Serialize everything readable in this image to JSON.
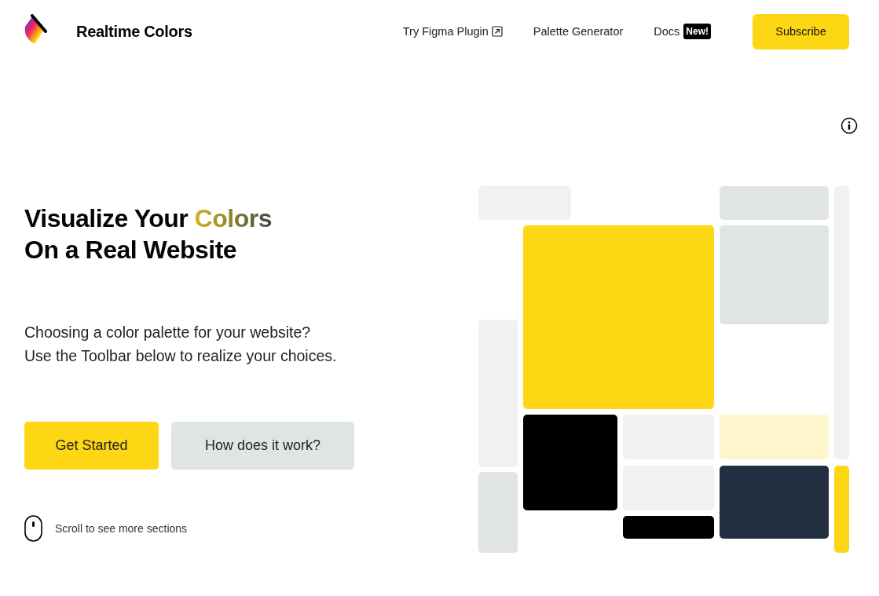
{
  "brand": {
    "name": "Realtime Colors"
  },
  "nav": [
    {
      "label": "Try Figma Plugin",
      "kind": "external"
    },
    {
      "label": "Palette Generator",
      "kind": "plain"
    },
    {
      "label": "Docs",
      "kind": "badge",
      "badge": "New!"
    }
  ],
  "subscribe": "Subscribe",
  "hero": {
    "lead": "Visualize Your",
    "highlight": "Colors",
    "second_line": "On a Real Website",
    "text": [
      "Choosing a color palette for your website?",
      "Use the Toolbar below to realize your choices."
    ],
    "buttons": [
      {
        "label": "Get Started",
        "kind": "primary"
      },
      {
        "label": "How does it work?",
        "kind": "secondary"
      }
    ],
    "scroll_hint": "Scroll to see more sections"
  }
}
